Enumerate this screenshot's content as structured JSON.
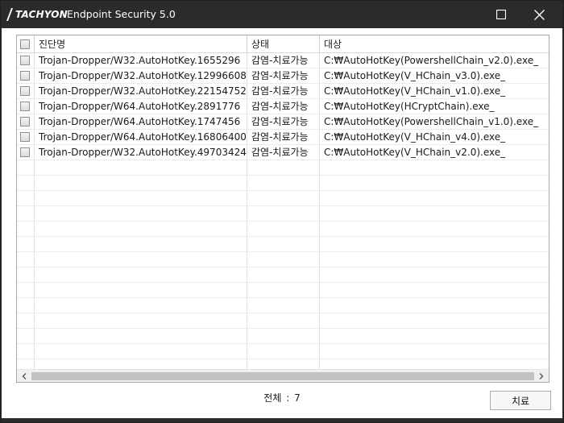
{
  "window": {
    "brand": "TACHYON",
    "title": "Endpoint Security 5.0"
  },
  "table": {
    "columns": [
      "진단명",
      "상태",
      "대상"
    ],
    "rows": [
      [
        "Trojan-Dropper/W32.AutoHotKey.1655296",
        "감염-치료가능",
        "C:₩AutoHotKey(PowershellChain_v2.0).exe_"
      ],
      [
        "Trojan-Dropper/W32.AutoHotKey.12996608",
        "감염-치료가능",
        "C:₩AutoHotKey(V_HChain_v3.0).exe_"
      ],
      [
        "Trojan-Dropper/W32.AutoHotKey.22154752",
        "감염-치료가능",
        "C:₩AutoHotKey(V_HChain_v1.0).exe_"
      ],
      [
        "Trojan-Dropper/W64.AutoHotKey.2891776",
        "감염-치료가능",
        "C:₩AutoHotKey(HCryptChain).exe_"
      ],
      [
        "Trojan-Dropper/W64.AutoHotKey.1747456",
        "감염-치료가능",
        "C:₩AutoHotKey(PowershellChain_v1.0).exe_"
      ],
      [
        "Trojan-Dropper/W64.AutoHotKey.16806400",
        "감염-치료가능",
        "C:₩AutoHotKey(V_HChain_v4.0).exe_"
      ],
      [
        "Trojan-Dropper/W32.AutoHotKey.49703424",
        "감염-치료가능",
        "C:₩AutoHotKey(V_HChain_v2.0).exe_"
      ]
    ]
  },
  "footer": {
    "total_label": "전체",
    "total_sep": ":",
    "total_count": "7",
    "action_label": "치료"
  }
}
